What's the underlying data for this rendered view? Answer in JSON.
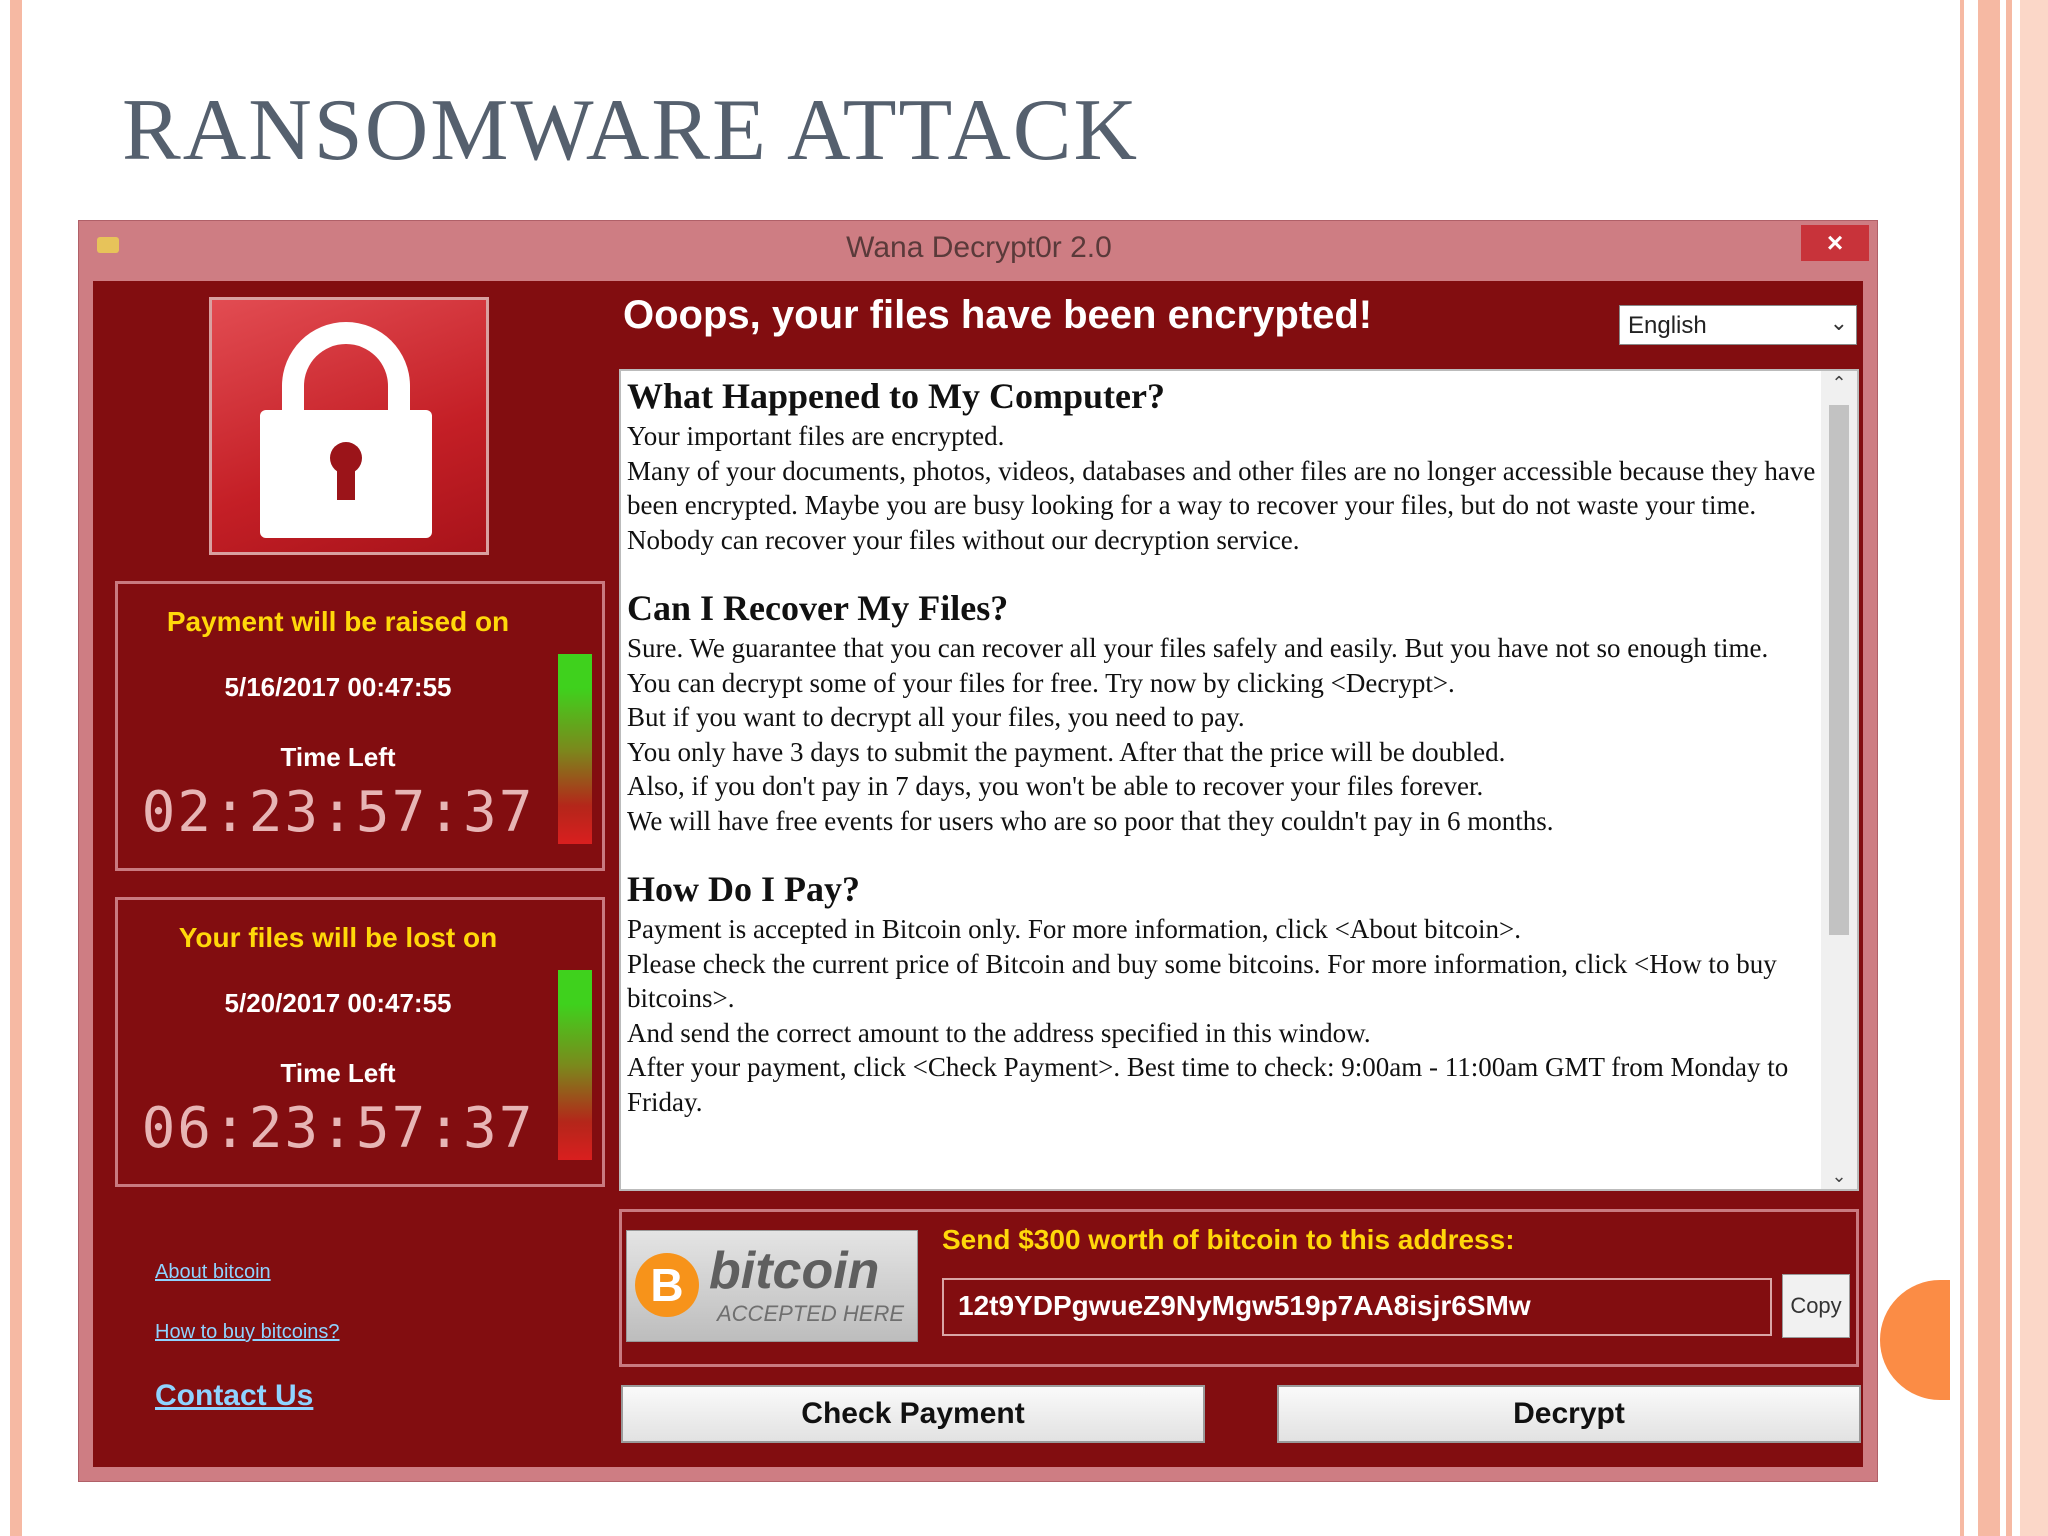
{
  "slide": {
    "title": "RANSOMWARE ATTACK"
  },
  "window": {
    "title": "Wana Decrypt0r 2.0",
    "close_label": "×"
  },
  "header": {
    "headline": "Ooops, your files have been encrypted!",
    "language": "English"
  },
  "timers": [
    {
      "heading": "Payment will be raised on",
      "date": "5/16/2017 00:47:55",
      "time_left_label": "Time Left",
      "countdown": "02:23:57:37"
    },
    {
      "heading": "Your files will be lost on",
      "date": "5/20/2017 00:47:55",
      "time_left_label": "Time Left",
      "countdown": "06:23:57:37"
    }
  ],
  "links": {
    "about_bitcoin": "About bitcoin",
    "how_to_buy": "How to buy bitcoins?",
    "contact_us": "Contact Us"
  },
  "message": {
    "sections": [
      {
        "heading": "What Happened to My Computer?",
        "lines": [
          "Your important files are encrypted.",
          "Many of your documents, photos, videos, databases and other files are no longer accessible because they have been encrypted. Maybe you are busy looking for a way to recover your files, but do not waste your time. Nobody can recover your files without our decryption service."
        ]
      },
      {
        "heading": "Can I Recover My Files?",
        "lines": [
          "Sure. We guarantee that you can recover all your files safely and easily. But you have not so enough time.",
          "You can decrypt some of your files for free. Try now by clicking <Decrypt>.",
          "But if you want to decrypt all your files, you need to pay.",
          "You only have 3 days to submit the payment. After that the price will be doubled.",
          "Also, if you don't pay in 7 days, you won't be able to recover your files forever.",
          "We will have free events for users who are so poor that they couldn't pay in 6 months."
        ]
      },
      {
        "heading": "How Do I Pay?",
        "lines": [
          "Payment is accepted in Bitcoin only. For more information, click <About bitcoin>.",
          "Please check the current price of Bitcoin and buy some bitcoins. For more information, click <How to buy bitcoins>.",
          "And send the correct amount to the address specified in this window.",
          "After your payment, click <Check Payment>. Best time to check: 9:00am - 11:00am GMT from Monday to Friday."
        ]
      }
    ]
  },
  "payment": {
    "logo_symbol": "B",
    "logo_word": "bitcoin",
    "logo_sub": "ACCEPTED HERE",
    "send_label": "Send $300 worth of bitcoin to this address:",
    "address": "12t9YDPgwueZ9NyMgw519p7AA8isjr6SMw",
    "copy_label": "Copy"
  },
  "buttons": {
    "check_payment": "Check Payment",
    "decrypt": "Decrypt"
  },
  "colors": {
    "window_bg": "#820d10",
    "accent_yellow": "#ffd80a",
    "link_blue": "#8fd3ff"
  }
}
